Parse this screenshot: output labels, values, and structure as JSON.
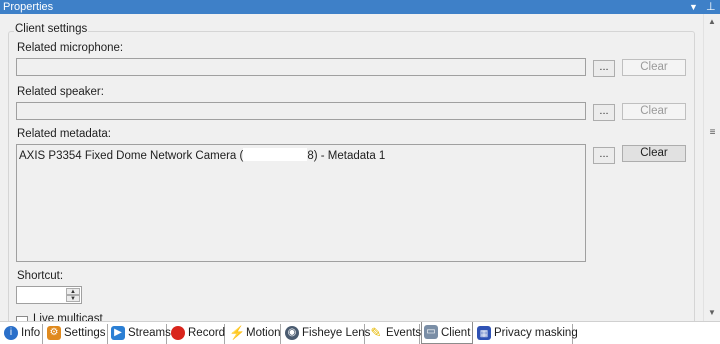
{
  "panel": {
    "title": "Properties",
    "dropdown_icon": "chevron-down-icon",
    "pin_icon": "pin-icon"
  },
  "group": {
    "title": "Client settings"
  },
  "microphone": {
    "label": "Related microphone:",
    "value": "",
    "browse": "...",
    "clear": "Clear"
  },
  "speaker": {
    "label": "Related speaker:",
    "value": "",
    "browse": "...",
    "clear": "Clear"
  },
  "metadata": {
    "label": "Related metadata:",
    "value_prefix": "AXIS P3354 Fixed Dome Network Camera (",
    "value_suffix": "8) - Metadata 1",
    "browse": "...",
    "clear": "Clear"
  },
  "shortcut": {
    "label": "Shortcut:",
    "value": ""
  },
  "live_multicast": {
    "label": "Live multicast",
    "checked": false
  },
  "tabs": [
    {
      "label": "Info",
      "icon": "info-icon",
      "color": "#2a6fc9"
    },
    {
      "label": "Settings",
      "icon": "settings-gear-icon",
      "color": "#e08a1e"
    },
    {
      "label": "Streams",
      "icon": "streams-icon",
      "color": "#2b7fd4"
    },
    {
      "label": "Record",
      "icon": "record-icon",
      "color": "#d9251c"
    },
    {
      "label": "Motion",
      "icon": "motion-icon",
      "color": "#2e9a2e"
    },
    {
      "label": "Fisheye Lens",
      "icon": "fisheye-lens-icon",
      "color": "#4a5b70"
    },
    {
      "label": "Events",
      "icon": "events-icon",
      "color": "#e6b800"
    },
    {
      "label": "Client",
      "icon": "client-monitor-icon",
      "color": "#7a8ea6"
    },
    {
      "label": "Privacy masking",
      "icon": "privacy-masking-icon",
      "color": "#2f52b5"
    }
  ],
  "active_tab": "Client"
}
